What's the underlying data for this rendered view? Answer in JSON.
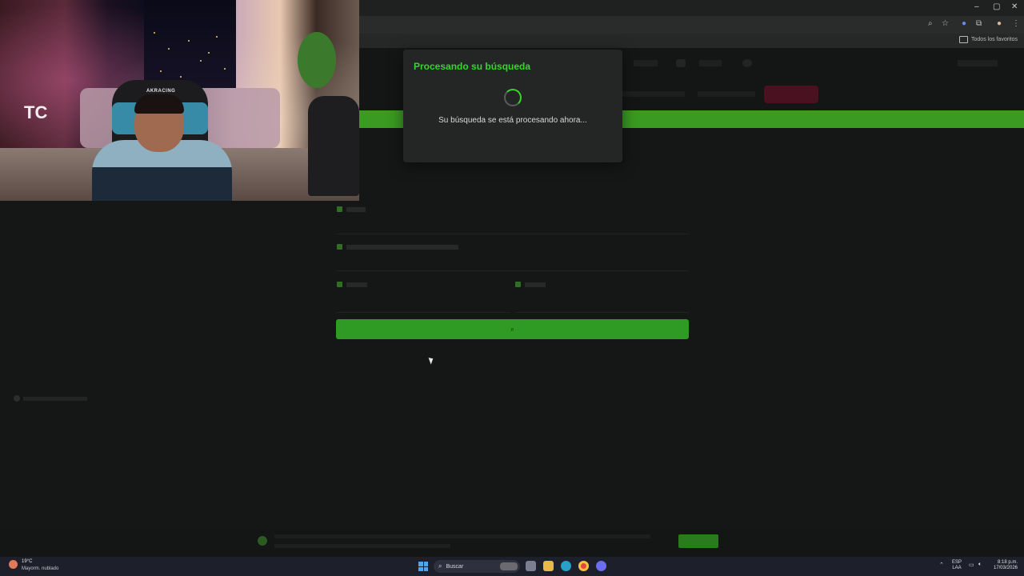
{
  "browser": {
    "window_controls": {
      "minimize": "–",
      "maximize": "▢",
      "close": "✕"
    },
    "bookmarks_folder": "Todos los favoritos"
  },
  "modal": {
    "title": "Procesando su búsqueda",
    "message": "Su búsqueda se está procesando ahora...",
    "accent_color": "#35d62a"
  },
  "taskbar": {
    "weather_temp": "19°C",
    "weather_desc": "Mayorm. nublado",
    "search_label": "Buscar",
    "lang_line1": "ESP",
    "lang_line2": "LAA",
    "time": "8:18 p.m.",
    "date": "17/03/2026"
  },
  "webcam": {
    "chair_brand": "AKRACING",
    "room_letters": "TC"
  }
}
